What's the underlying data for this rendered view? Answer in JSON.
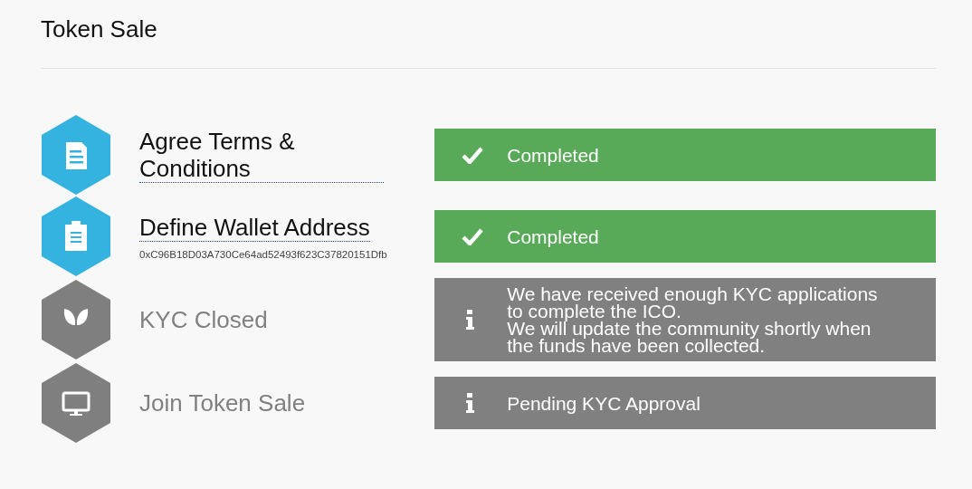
{
  "page": {
    "title": "Token Sale"
  },
  "steps": [
    {
      "kind": "document",
      "title": "Agree Terms & Conditions",
      "done": true,
      "status": {
        "kind": "success",
        "lines": [
          "Completed"
        ]
      }
    },
    {
      "kind": "clipboard",
      "title": "Define Wallet Address",
      "done": true,
      "detail": "0xC96B18D03A730Ce64ad52493f623C37820151Dfb",
      "status": {
        "kind": "success",
        "lines": [
          "Completed"
        ]
      }
    },
    {
      "kind": "leaf",
      "title": "KYC Closed",
      "done": false,
      "status": {
        "kind": "info",
        "lines": [
          "We have received enough KYC applications to complete the ICO.",
          "We will update the community shortly when the funds have been collected."
        ]
      }
    },
    {
      "kind": "monitor",
      "title": "Join Token Sale",
      "done": false,
      "status": {
        "kind": "info",
        "lines": [
          "Pending KYC Approval"
        ]
      }
    }
  ]
}
